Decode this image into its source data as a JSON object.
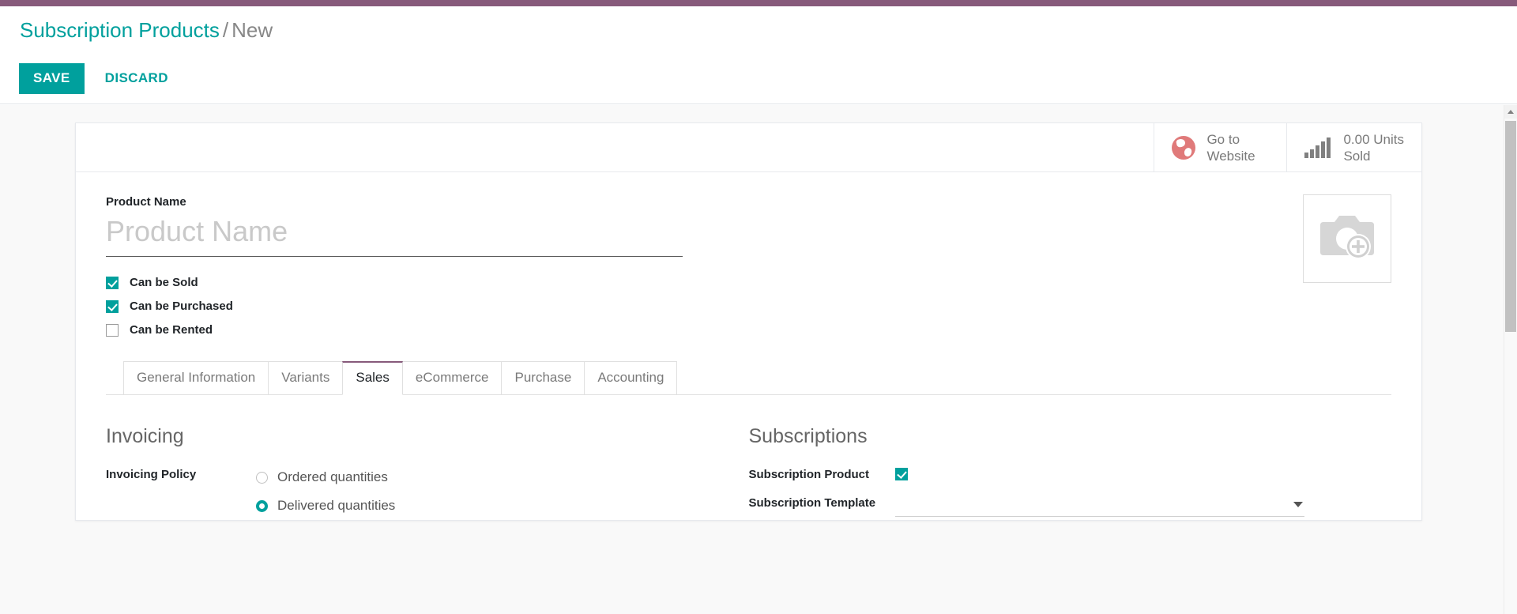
{
  "theme": {
    "accent_purple": "#875a7b",
    "accent_teal": "#00a09d",
    "globe_red": "#e07a7a",
    "muted_text": "#7a7a7a"
  },
  "breadcrumb": {
    "root": "Subscription Products",
    "separator": "/",
    "current": "New"
  },
  "actions": {
    "save_label": "SAVE",
    "discard_label": "DISCARD"
  },
  "stat_buttons": [
    {
      "icon": "globe-icon",
      "line1": "Go to",
      "line2": "Website"
    },
    {
      "icon": "bar-chart-icon",
      "line1": "0.00 Units",
      "line2": "Sold"
    }
  ],
  "product": {
    "name_label": "Product Name",
    "name_value": "",
    "name_placeholder": "Product Name",
    "image_icon": "camera-add-icon",
    "flags": [
      {
        "label": "Can be Sold",
        "checked": true
      },
      {
        "label": "Can be Purchased",
        "checked": true
      },
      {
        "label": "Can be Rented",
        "checked": false
      }
    ]
  },
  "tabs": [
    {
      "label": "General Information",
      "active": false
    },
    {
      "label": "Variants",
      "active": false
    },
    {
      "label": "Sales",
      "active": true
    },
    {
      "label": "eCommerce",
      "active": false
    },
    {
      "label": "Purchase",
      "active": false
    },
    {
      "label": "Accounting",
      "active": false
    }
  ],
  "sales_tab": {
    "invoicing": {
      "title": "Invoicing",
      "policy_label": "Invoicing Policy",
      "options": [
        {
          "label": "Ordered quantities",
          "selected": false
        },
        {
          "label": "Delivered quantities",
          "selected": true
        }
      ]
    },
    "subscriptions": {
      "title": "Subscriptions",
      "product_label": "Subscription Product",
      "product_checked": true,
      "template_label": "Subscription Template",
      "template_value": "",
      "template_placeholder": ""
    }
  },
  "scrollbar": {
    "up_arrow": "chevron-up-icon"
  }
}
